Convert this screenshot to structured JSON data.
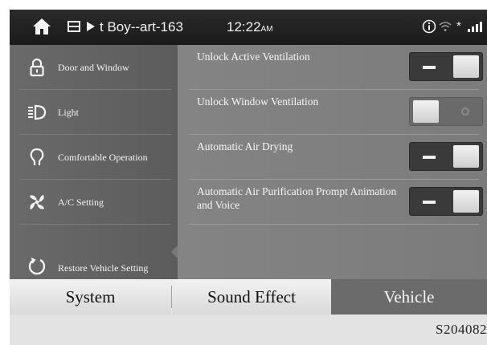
{
  "status_bar": {
    "track": "t Boy--art-163",
    "time": "12:22",
    "ampm": "AM",
    "bluetooth_glyph": "*",
    "icons": [
      "home-icon",
      "media-source-icon",
      "play-icon",
      "info-icon",
      "wifi-icon",
      "bluetooth-icon",
      "signal-icon"
    ]
  },
  "sidebar": {
    "items": [
      {
        "label": "Door and Window",
        "icon": "lock-icon"
      },
      {
        "label": "Light",
        "icon": "headlight-icon"
      },
      {
        "label": "Comfortable Operation",
        "icon": "comfort-icon"
      },
      {
        "label": "A/C Setting",
        "icon": "fan-icon",
        "selected": true
      },
      {
        "label": "Restore Vehicle Setting",
        "icon": "restore-icon"
      }
    ]
  },
  "settings": [
    {
      "label": "Unlock Active Ventilation",
      "on": true
    },
    {
      "label": "Unlock Window Ventilation",
      "on": false
    },
    {
      "label": "Automatic Air Drying",
      "on": true
    },
    {
      "label": "Automatic Air Purification Prompt Animation and Voice",
      "on": true
    }
  ],
  "tabs": [
    {
      "label": "System",
      "active": false
    },
    {
      "label": "Sound Effect",
      "active": false
    },
    {
      "label": "Vehicle",
      "active": true
    }
  ],
  "figure_code": "S204082",
  "colors": {
    "status_bar": "#1f1f1f",
    "sidebar": "#626262",
    "panel": "#808080",
    "toggle_on": "#3a3a3a",
    "active_tab": "#6b6b6b"
  }
}
